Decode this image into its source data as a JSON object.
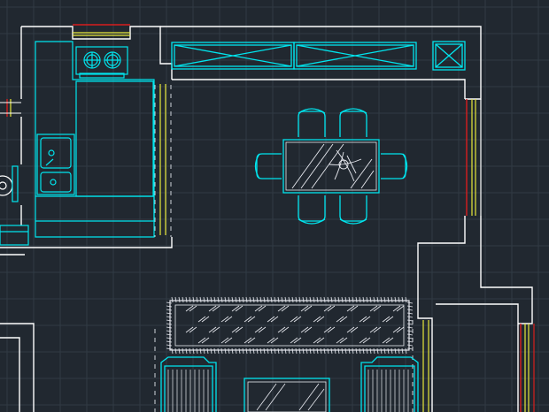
{
  "drawing": {
    "layers": {
      "walls": "#ffffff",
      "furniture": "#00e5ee",
      "windows_red": "#d81e1e",
      "windows_yellow": "#e8e83a",
      "hatch": "#e8eaf0",
      "dashed": "#cfd3da",
      "grid": "#3a434d"
    },
    "background": "#212830",
    "objects": [
      "kitchen-counter",
      "gas-stove",
      "double-sink",
      "tall-cabinet",
      "wall-cabinet-1",
      "wall-cabinet-2",
      "dining-table",
      "chairs",
      "sofa",
      "coffee-table",
      "rug",
      "window-top",
      "window-right",
      "window-left"
    ]
  }
}
